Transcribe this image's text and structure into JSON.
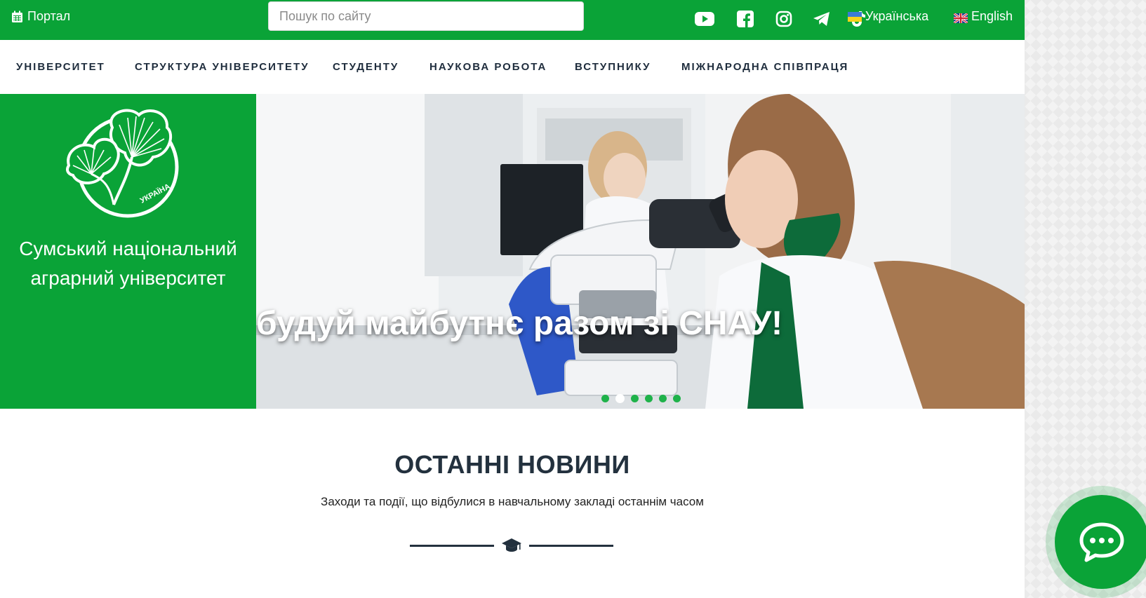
{
  "topbar": {
    "portal_label": "Портал",
    "search": {
      "placeholder": "Пошук по сайту",
      "value": ""
    },
    "social_icons": [
      "youtube-icon",
      "facebook-icon",
      "instagram-icon",
      "telegram-icon",
      "tiktok-icon"
    ],
    "languages": [
      {
        "label": "Українська",
        "flag": "ukraine-flag-icon"
      },
      {
        "label": "English",
        "flag": "uk-flag-icon"
      }
    ]
  },
  "nav": {
    "items": [
      {
        "label": "УНІВЕРСИТЕТ"
      },
      {
        "label": "СТРУКТУРА УНІВЕРСИТЕТУ"
      },
      {
        "label": "СТУДЕНТУ"
      },
      {
        "label": "НАУКОВА РОБОТА"
      },
      {
        "label": "ВСТУПНИКУ"
      },
      {
        "label": "МІЖНАРОДНА СПІВПРАЦЯ"
      }
    ]
  },
  "hero": {
    "university_name": "Сумський національний аграрний університет",
    "logo_text": "УКРАЇНА",
    "slide_caption": "будуй майбутнє разом зі СНАУ!",
    "slide_count": 6,
    "active_slide": 2
  },
  "news": {
    "title": "ОСТАННІ НОВИНИ",
    "subtitle": "Заходи та події, що відбулися в навчальному закладі останнім часом",
    "divider_icon": "graduation-cap-icon"
  },
  "chat": {
    "icon": "chat-bubble-icon"
  },
  "colors": {
    "brand_green": "#0aa337",
    "nav_text": "#1f2d3d",
    "heading": "#23313e"
  }
}
